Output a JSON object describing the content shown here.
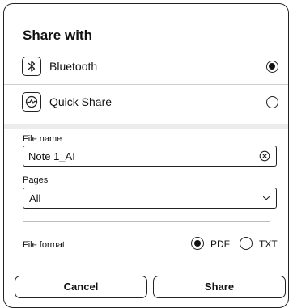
{
  "dialog": {
    "title": "Share with"
  },
  "share_targets": [
    {
      "label": "Bluetooth",
      "icon": "bluetooth-icon",
      "selected": true
    },
    {
      "label": "Quick Share",
      "icon": "quick-share-icon",
      "selected": false
    }
  ],
  "file_name": {
    "label": "File name",
    "value": "Note 1_AI"
  },
  "pages": {
    "label": "Pages",
    "selected": "All"
  },
  "file_format": {
    "label": "File format",
    "options": [
      {
        "label": "PDF",
        "selected": true
      },
      {
        "label": "TXT",
        "selected": false
      }
    ]
  },
  "actions": {
    "cancel_label": "Cancel",
    "share_label": "Share"
  }
}
